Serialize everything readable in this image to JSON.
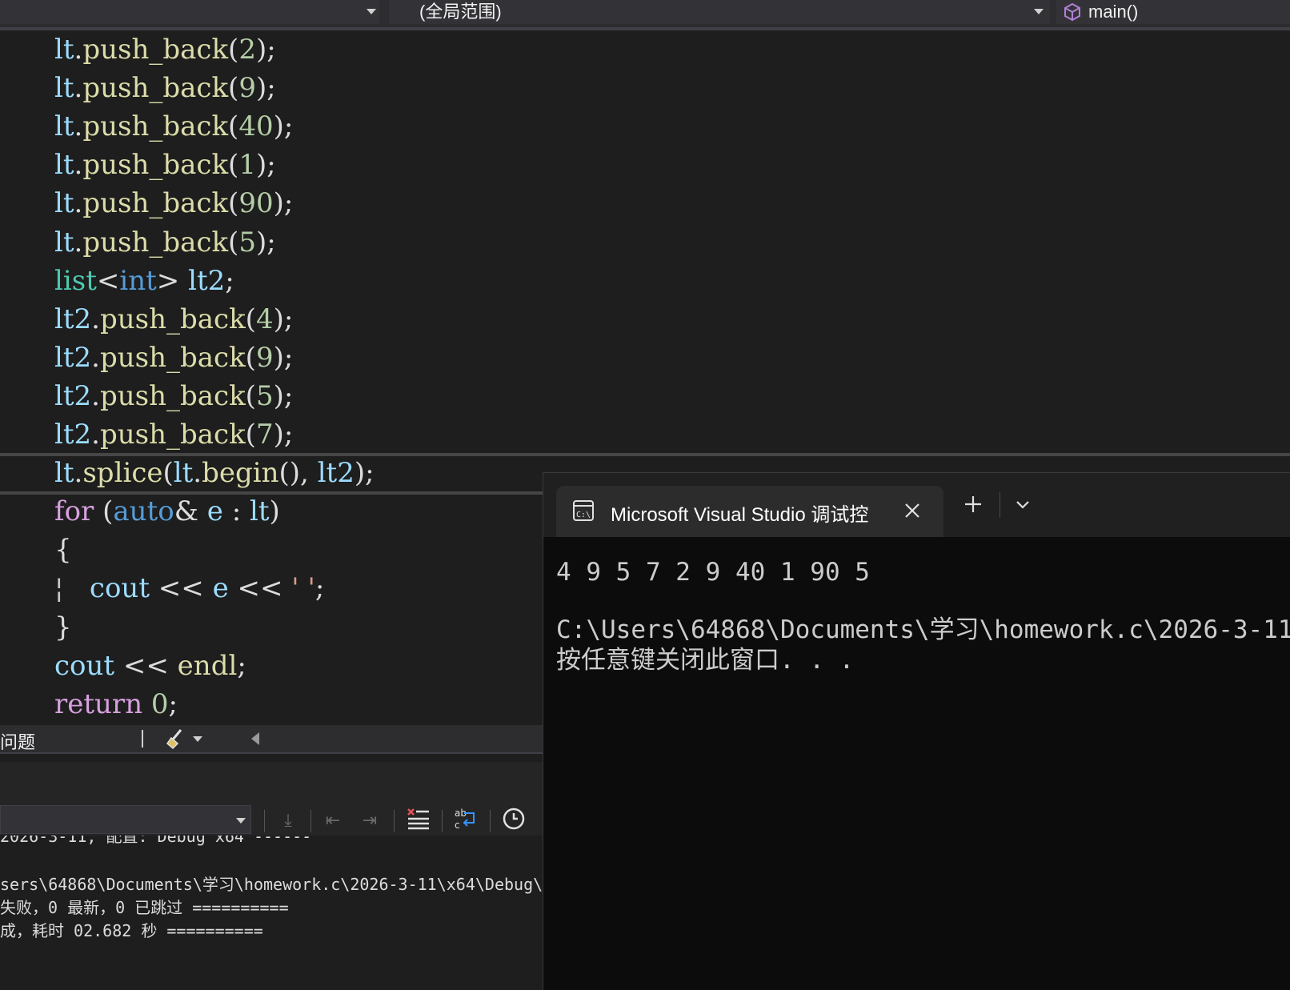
{
  "nav": {
    "scope": "(全局范围)",
    "member": "main()"
  },
  "code": {
    "lines": [
      [
        [
          "lt",
          "var"
        ],
        [
          ".",
          "pun"
        ],
        [
          "push_back",
          "fn"
        ],
        [
          "(",
          "pun"
        ],
        [
          "2",
          "num"
        ],
        [
          ")",
          "pun"
        ],
        [
          ";",
          "pun"
        ]
      ],
      [
        [
          "lt",
          "var"
        ],
        [
          ".",
          "pun"
        ],
        [
          "push_back",
          "fn"
        ],
        [
          "(",
          "pun"
        ],
        [
          "9",
          "num"
        ],
        [
          ")",
          "pun"
        ],
        [
          ";",
          "pun"
        ]
      ],
      [
        [
          "lt",
          "var"
        ],
        [
          ".",
          "pun"
        ],
        [
          "push_back",
          "fn"
        ],
        [
          "(",
          "pun"
        ],
        [
          "40",
          "num"
        ],
        [
          ")",
          "pun"
        ],
        [
          ";",
          "pun"
        ]
      ],
      [
        [
          "lt",
          "var"
        ],
        [
          ".",
          "pun"
        ],
        [
          "push_back",
          "fn"
        ],
        [
          "(",
          "pun"
        ],
        [
          "1",
          "num"
        ],
        [
          ")",
          "pun"
        ],
        [
          ";",
          "pun"
        ]
      ],
      [
        [
          "lt",
          "var"
        ],
        [
          ".",
          "pun"
        ],
        [
          "push_back",
          "fn"
        ],
        [
          "(",
          "pun"
        ],
        [
          "90",
          "num"
        ],
        [
          ")",
          "pun"
        ],
        [
          ";",
          "pun"
        ]
      ],
      [
        [
          "lt",
          "var"
        ],
        [
          ".",
          "pun"
        ],
        [
          "push_back",
          "fn"
        ],
        [
          "(",
          "pun"
        ],
        [
          "5",
          "num"
        ],
        [
          ")",
          "pun"
        ],
        [
          ";",
          "pun"
        ]
      ],
      [
        [
          "list",
          "type"
        ],
        [
          "<",
          "pun"
        ],
        [
          "int",
          "kw"
        ],
        [
          "> ",
          "pun"
        ],
        [
          "lt2",
          "var"
        ],
        [
          ";",
          "pun"
        ]
      ],
      [
        [
          "lt2",
          "var"
        ],
        [
          ".",
          "pun"
        ],
        [
          "push_back",
          "fn"
        ],
        [
          "(",
          "pun"
        ],
        [
          "4",
          "num"
        ],
        [
          ")",
          "pun"
        ],
        [
          ";",
          "pun"
        ]
      ],
      [
        [
          "lt2",
          "var"
        ],
        [
          ".",
          "pun"
        ],
        [
          "push_back",
          "fn"
        ],
        [
          "(",
          "pun"
        ],
        [
          "9",
          "num"
        ],
        [
          ")",
          "pun"
        ],
        [
          ";",
          "pun"
        ]
      ],
      [
        [
          "lt2",
          "var"
        ],
        [
          ".",
          "pun"
        ],
        [
          "push_back",
          "fn"
        ],
        [
          "(",
          "pun"
        ],
        [
          "5",
          "num"
        ],
        [
          ")",
          "pun"
        ],
        [
          ";",
          "pun"
        ]
      ],
      [
        [
          "lt2",
          "var"
        ],
        [
          ".",
          "pun"
        ],
        [
          "push_back",
          "fn"
        ],
        [
          "(",
          "pun"
        ],
        [
          "7",
          "num"
        ],
        [
          ")",
          "pun"
        ],
        [
          ";",
          "pun"
        ]
      ],
      [
        [
          "lt",
          "var"
        ],
        [
          ".",
          "pun"
        ],
        [
          "splice",
          "fn"
        ],
        [
          "(",
          "pun"
        ],
        [
          "lt",
          "var"
        ],
        [
          ".",
          "pun"
        ],
        [
          "begin",
          "fn"
        ],
        [
          "(), ",
          "pun"
        ],
        [
          "lt2",
          "var"
        ],
        [
          ");",
          "pun"
        ]
      ],
      [
        [
          "for",
          "ctl"
        ],
        [
          " (",
          "pun"
        ],
        [
          "auto",
          "kw"
        ],
        [
          "& ",
          "pun"
        ],
        [
          "e",
          "var"
        ],
        [
          " : ",
          "pun"
        ],
        [
          "lt",
          "var"
        ],
        [
          ")",
          "pun"
        ]
      ],
      [
        [
          "{",
          "pun"
        ]
      ],
      [
        [
          "¦",
          "gray"
        ],
        [
          "   ",
          "pun"
        ],
        [
          "cout",
          "var"
        ],
        [
          " << ",
          "pun"
        ],
        [
          "e",
          "var"
        ],
        [
          " << ",
          "pun"
        ],
        [
          "' '",
          "str"
        ],
        [
          ";",
          "pun"
        ]
      ],
      [
        [
          "}",
          "pun"
        ]
      ],
      [
        [
          "cout",
          "var"
        ],
        [
          " << ",
          "pun"
        ],
        [
          "endl",
          "fn"
        ],
        [
          ";",
          "pun"
        ]
      ],
      [
        [
          "return",
          "ctl"
        ],
        [
          " ",
          "pun"
        ],
        [
          "0",
          "num"
        ],
        [
          ";",
          "pun"
        ]
      ]
    ]
  },
  "panel": {
    "title": "问题"
  },
  "output": {
    "lines": [
      "2026-3-11, 配置: Debug x64 ------",
      "",
      "sers\\64868\\Documents\\学习\\homework.c\\2026-3-11\\x64\\Debug\\",
      "失败，0 最新，0 已跳过 ==========",
      "成，耗时 02.682 秒 =========="
    ]
  },
  "terminal": {
    "tab_title": "Microsoft Visual Studio 调试控",
    "lines": [
      "4 9 5 7 2 9 40 1 90 5",
      "",
      "C:\\Users\\64868\\Documents\\学习\\homework.c\\2026-3-11",
      "按任意键关闭此窗口. . ."
    ]
  }
}
